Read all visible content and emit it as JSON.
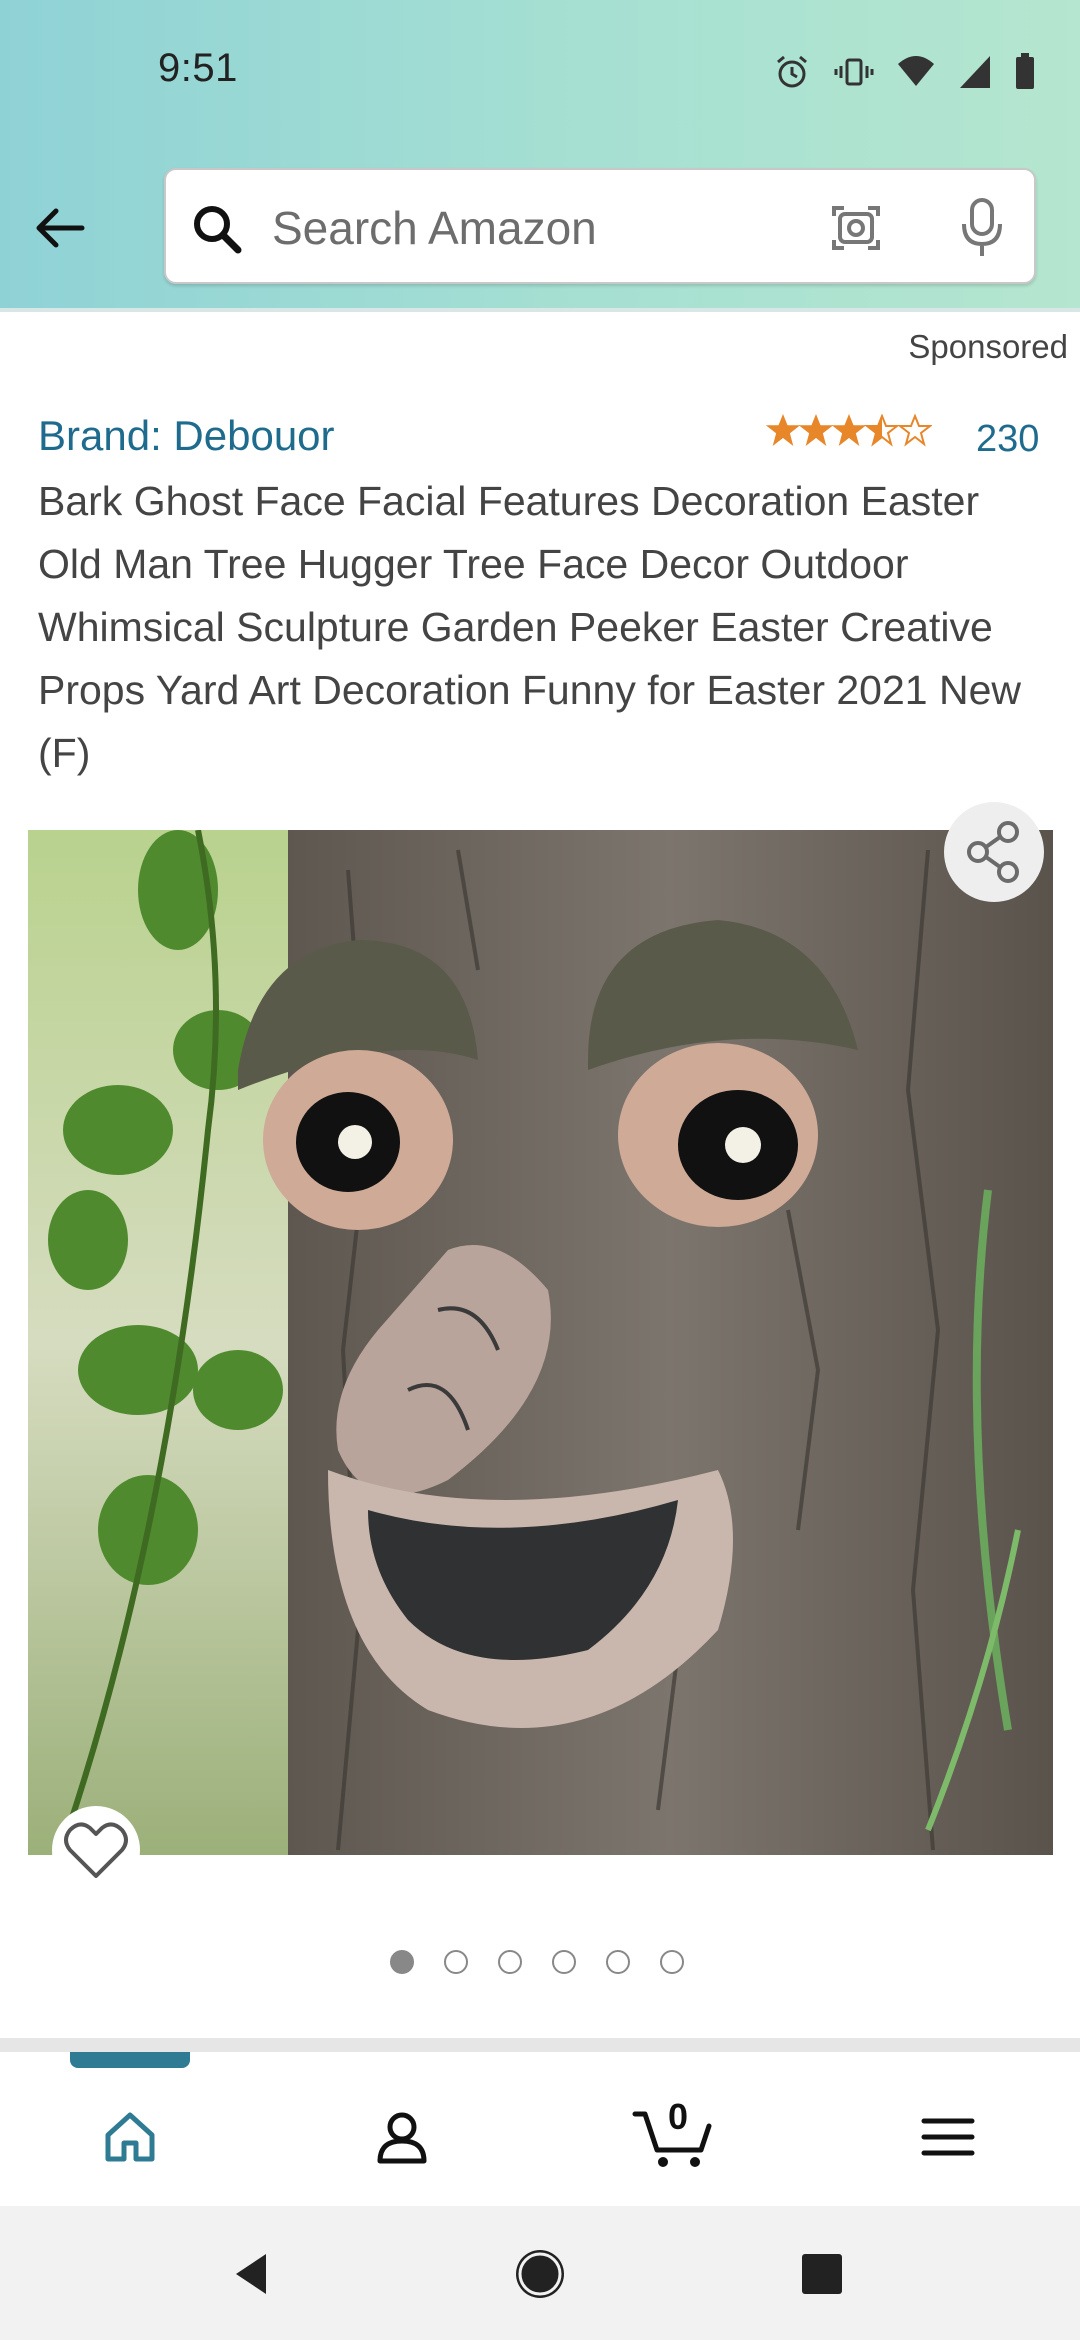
{
  "status_bar": {
    "time": "9:51"
  },
  "search": {
    "placeholder": "Search Amazon"
  },
  "product": {
    "sponsored_label": "Sponsored",
    "brand": "Brand: Debouor",
    "rating": 3.5,
    "rating_count": "230",
    "title": "Bark Ghost Face Facial Features Decoration Easter Old Man Tree Hugger Tree Face Decor Outdoor Whimsical Sculpture Garden Peeker Easter Creative Props Yard Art Decoration Funny for Easter 2021 New (F)",
    "image_count": 6,
    "active_image_index": 0
  },
  "bottom_nav": {
    "items": [
      {
        "icon": "home-icon",
        "active": true
      },
      {
        "icon": "account-icon",
        "active": false
      },
      {
        "icon": "cart-icon",
        "active": false
      },
      {
        "icon": "menu-icon",
        "active": false
      }
    ],
    "cart_count": "0"
  },
  "colors": {
    "header_start": "#8fd2d6",
    "header_end": "#b5e6cf",
    "link": "#1f6b8d",
    "star": "#e8862a",
    "nav_active": "#2f7b93"
  }
}
